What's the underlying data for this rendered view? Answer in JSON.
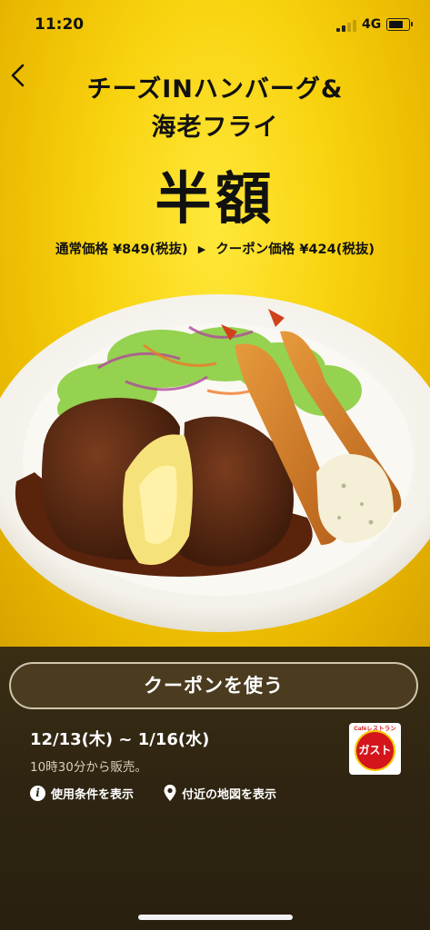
{
  "status": {
    "time": "11:20",
    "network": "4G"
  },
  "promo": {
    "title_line1": "チーズINハンバーグ&",
    "title_line2": "海老フライ",
    "headline": "半額",
    "regular_price_label": "通常価格 ¥849(税抜)",
    "arrow": "▶",
    "coupon_price_label": "クーポン価格 ¥424(税抜)"
  },
  "coupon": {
    "button_label": "クーポンを使う",
    "period": "12/13(木) ~ 1/16(水)",
    "sales_time": "10時30分から販売。",
    "terms_link": "使用条件を表示",
    "map_link": "付近の地図を表示"
  },
  "brand": {
    "tagline": "Caféレストラン",
    "name": "ガスト"
  },
  "colors": {
    "hero_yellow": "#f8d20e",
    "panel_brown": "#2e2411",
    "logo_red": "#d4161c"
  },
  "icons": {
    "back": "chevron-left-icon",
    "info": "info-icon",
    "map": "map-pin-icon"
  }
}
